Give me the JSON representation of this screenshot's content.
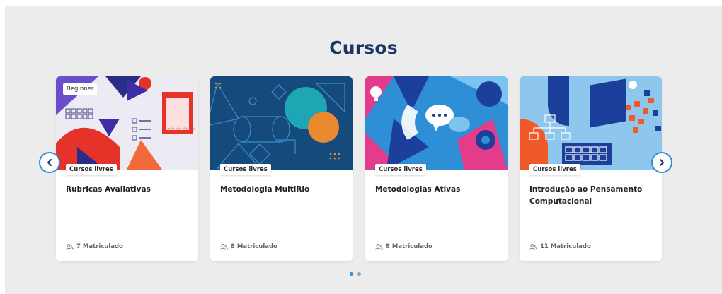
{
  "section": {
    "title": "Cursos"
  },
  "courses": [
    {
      "level": "Beginner",
      "category": "Cursos livres",
      "title": "Rubricas Avaliativas",
      "enrolled": "7 Matriculado"
    },
    {
      "category": "Cursos livres",
      "title": "Metodologia MultiRio",
      "enrolled": "8 Matriculado"
    },
    {
      "category": "Cursos livres",
      "title": "Metodologias Ativas",
      "enrolled": "8 Matriculado"
    },
    {
      "category": "Cursos livres",
      "title": "Introdução ao Pensamento Computacional",
      "enrolled": "11 Matriculado"
    }
  ],
  "navigation": {
    "prev_icon": "chevron-left-icon",
    "next_icon": "chevron-right-icon"
  },
  "pagination": {
    "pages": 2,
    "active": 1
  },
  "colors": {
    "title": "#1b3666",
    "accent": "#2d8fd1",
    "background": "#ececec"
  }
}
